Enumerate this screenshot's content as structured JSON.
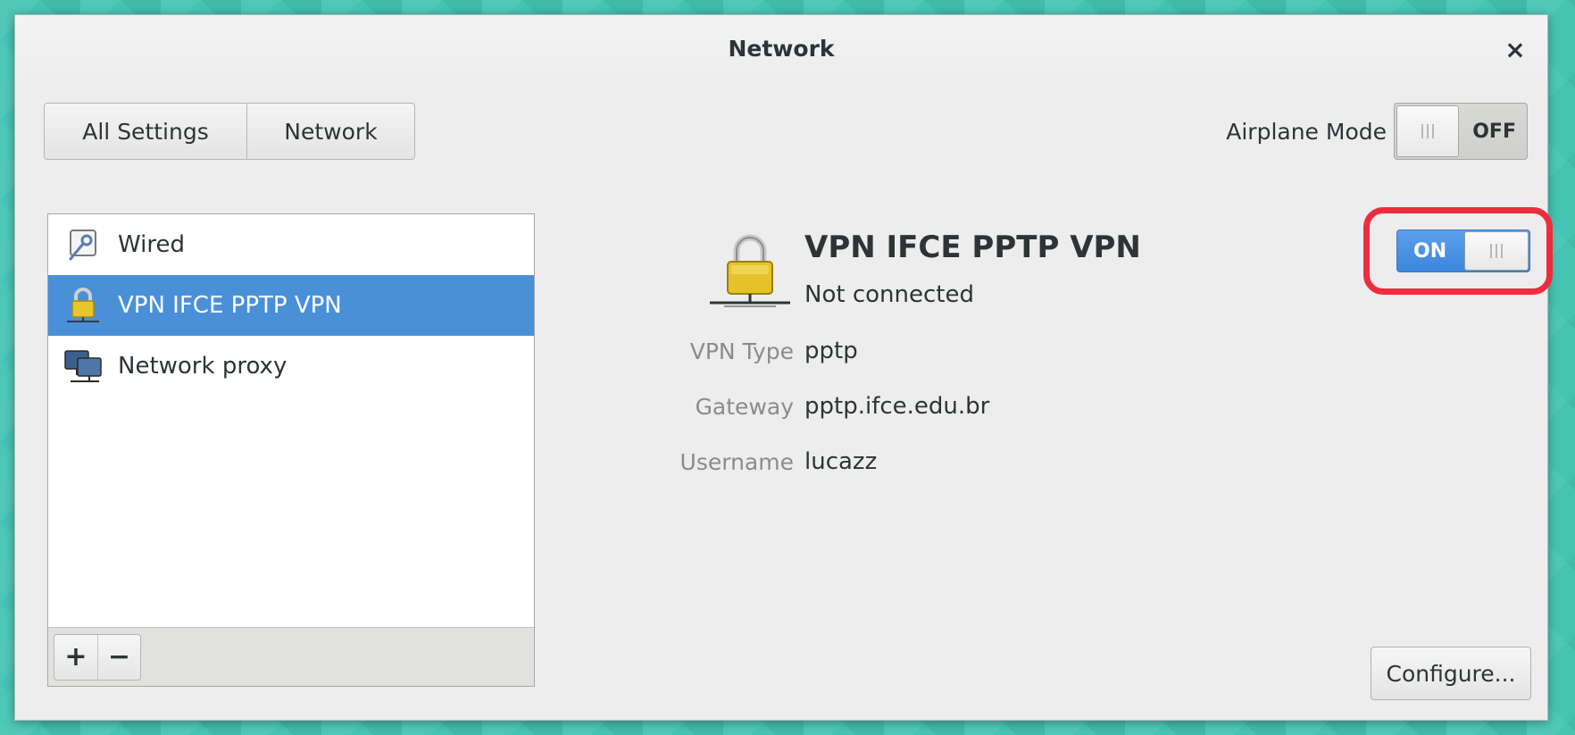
{
  "window": {
    "title": "Network"
  },
  "breadcrumbs": [
    {
      "label": "All Settings"
    },
    {
      "label": "Network"
    }
  ],
  "airplane_mode": {
    "label": "Airplane Mode",
    "state": "OFF"
  },
  "devices": [
    {
      "label": "Wired",
      "icon": "wired-icon",
      "selected": false
    },
    {
      "label": "VPN IFCE PPTP VPN",
      "icon": "vpn-lock-icon",
      "selected": true
    },
    {
      "label": "Network proxy",
      "icon": "network-proxy-icon",
      "selected": false
    }
  ],
  "list_toolbar": {
    "add": "+",
    "remove": "−"
  },
  "detail": {
    "name": "VPN IFCE PPTP VPN",
    "status": "Not connected",
    "switch_state": "ON",
    "properties": [
      {
        "label": "VPN Type",
        "value": "pptp"
      },
      {
        "label": "Gateway",
        "value": "pptp.ifce.edu.br"
      },
      {
        "label": "Username",
        "value": "lucazz"
      }
    ],
    "configure_label": "Configure..."
  },
  "colors": {
    "selection": "#4a90d9",
    "switch_on": "#3d86dd",
    "highlight": "#ee2d3c",
    "desktop": "#45c4b4"
  }
}
